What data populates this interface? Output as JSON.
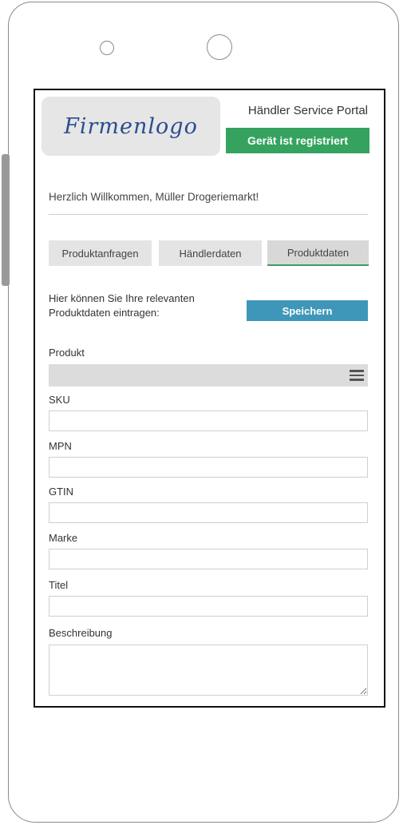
{
  "header": {
    "logo_text": "Firmenlogo",
    "portal_title": "Händler Service Portal",
    "registration_status": "Gerät ist registriert"
  },
  "welcome": "Herzlich Willkommen, Müller Drogeriemarkt!",
  "tabs": [
    {
      "label": "Produktanfragen"
    },
    {
      "label": "Händlerdaten"
    },
    {
      "label": "Produktdaten",
      "active": true
    }
  ],
  "intro": {
    "line1": "Hier können Sie Ihre relevanten",
    "line2": "Produktdaten eintragen:"
  },
  "save_label": "Speichern",
  "form": {
    "product_label": "Produkt",
    "sku_label": "SKU",
    "mpn_label": "MPN",
    "gtin_label": "GTIN",
    "brand_label": "Marke",
    "title_label": "Titel",
    "description_label": "Beschreibung"
  },
  "colors": {
    "registered_badge": "#35a35f",
    "save_button": "#3e97b8",
    "active_tab_underline": "#3aa25a",
    "logo_text": "#2b4d8f"
  }
}
